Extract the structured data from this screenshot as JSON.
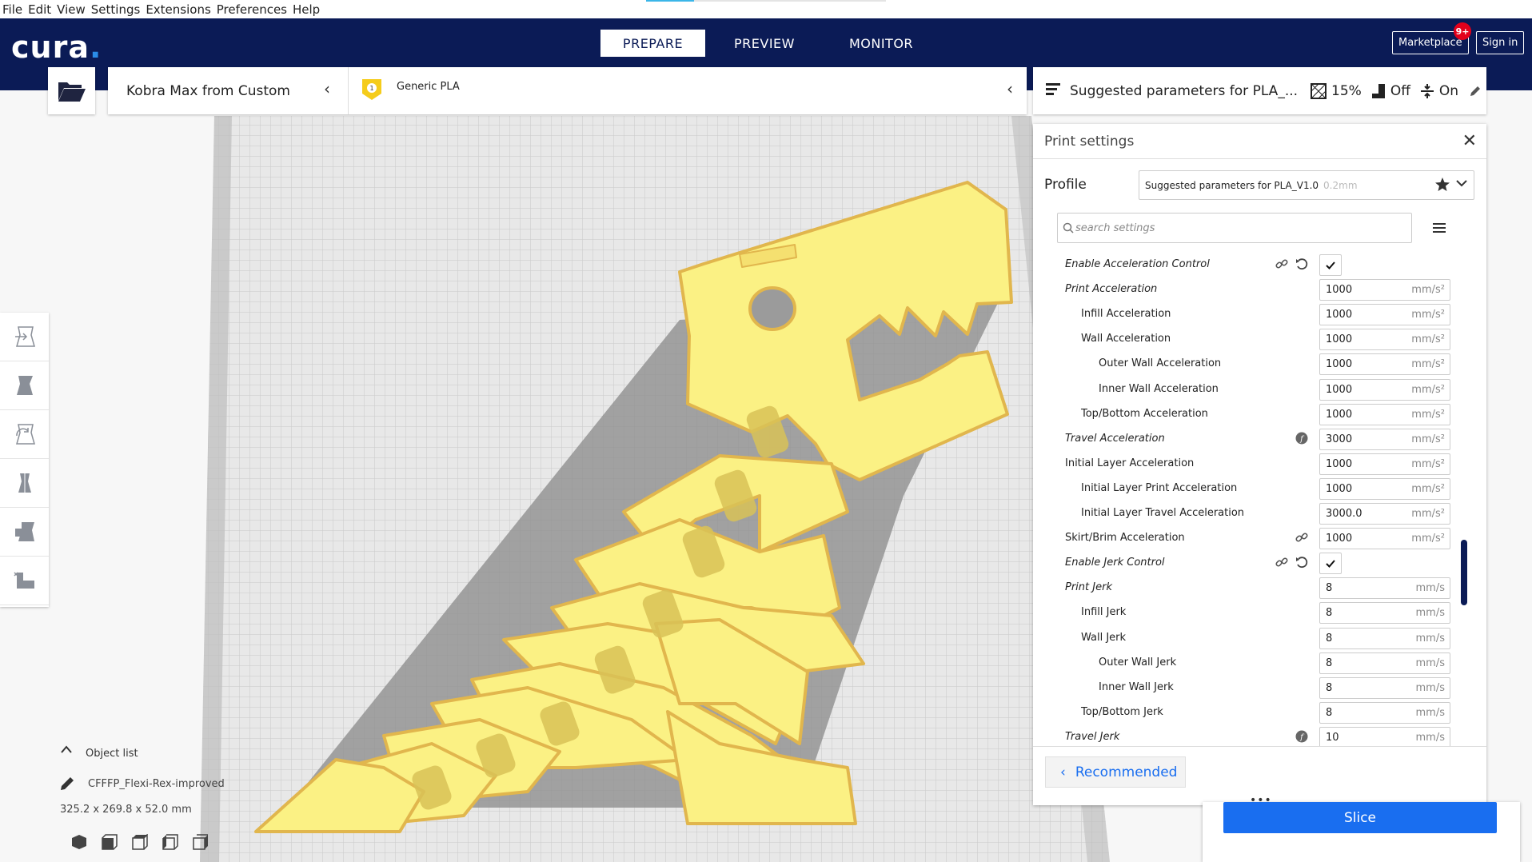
{
  "menu": [
    "File",
    "Edit",
    "View",
    "Settings",
    "Extensions",
    "Preferences",
    "Help"
  ],
  "brand": {
    "logo": "cura",
    "navy": "#0b1b56",
    "accent": "#196ef0"
  },
  "stages": [
    {
      "label": "PREPARE",
      "active": true
    },
    {
      "label": "PREVIEW",
      "active": false
    },
    {
      "label": "MONITOR",
      "active": false
    }
  ],
  "header_buttons": {
    "marketplace": "Marketplace",
    "marketplace_badge": "9+",
    "sign_in": "Sign in"
  },
  "printer": {
    "name": "Kobra Max from Custom"
  },
  "material": {
    "extruder_number": "1",
    "name": "Generic PLA",
    "color": "#f5cc1b"
  },
  "profile_bar": {
    "name": "Suggested parameters for PLA_...",
    "infill": "15%",
    "support": "Off",
    "adhesion": "On"
  },
  "print_settings": {
    "title": "Print settings",
    "profile_label": "Profile",
    "profile_value": "Suggested parameters for PLA_V1.0",
    "profile_sub": "0.2mm",
    "search_placeholder": "search settings",
    "rows": [
      {
        "label": "Enable Acceleration Control",
        "italic": true,
        "indent": 0,
        "type": "check",
        "link": true,
        "reset": true
      },
      {
        "label": "Print Acceleration",
        "italic": true,
        "indent": 0,
        "value": "1000",
        "unit": "mm/s²"
      },
      {
        "label": "Infill Acceleration",
        "italic": false,
        "indent": 1,
        "value": "1000",
        "unit": "mm/s²"
      },
      {
        "label": "Wall Acceleration",
        "italic": false,
        "indent": 1,
        "value": "1000",
        "unit": "mm/s²"
      },
      {
        "label": "Outer Wall Acceleration",
        "italic": false,
        "indent": 2,
        "value": "1000",
        "unit": "mm/s²"
      },
      {
        "label": "Inner Wall Acceleration",
        "italic": false,
        "indent": 2,
        "value": "1000",
        "unit": "mm/s²"
      },
      {
        "label": "Top/Bottom Acceleration",
        "italic": false,
        "indent": 1,
        "value": "1000",
        "unit": "mm/s²"
      },
      {
        "label": "Travel Acceleration",
        "italic": true,
        "indent": 0,
        "value": "3000",
        "unit": "mm/s²",
        "info": true
      },
      {
        "label": "Initial Layer Acceleration",
        "italic": false,
        "indent": 0,
        "value": "1000",
        "unit": "mm/s²"
      },
      {
        "label": "Initial Layer Print Acceleration",
        "italic": false,
        "indent": 1,
        "value": "1000",
        "unit": "mm/s²"
      },
      {
        "label": "Initial Layer Travel Acceleration",
        "italic": false,
        "indent": 1,
        "value": "3000.0",
        "unit": "mm/s²"
      },
      {
        "label": "Skirt/Brim Acceleration",
        "italic": false,
        "indent": 0,
        "value": "1000",
        "unit": "mm/s²",
        "link": true
      },
      {
        "label": "Enable Jerk Control",
        "italic": true,
        "indent": 0,
        "type": "check",
        "link": true,
        "reset": true
      },
      {
        "label": "Print Jerk",
        "italic": true,
        "indent": 0,
        "value": "8",
        "unit": "mm/s"
      },
      {
        "label": "Infill Jerk",
        "italic": false,
        "indent": 1,
        "value": "8",
        "unit": "mm/s"
      },
      {
        "label": "Wall Jerk",
        "italic": false,
        "indent": 1,
        "value": "8",
        "unit": "mm/s"
      },
      {
        "label": "Outer Wall Jerk",
        "italic": false,
        "indent": 2,
        "value": "8",
        "unit": "mm/s"
      },
      {
        "label": "Inner Wall Jerk",
        "italic": false,
        "indent": 2,
        "value": "8",
        "unit": "mm/s"
      },
      {
        "label": "Top/Bottom Jerk",
        "italic": false,
        "indent": 1,
        "value": "8",
        "unit": "mm/s"
      },
      {
        "label": "Travel Jerk",
        "italic": true,
        "indent": 0,
        "value": "10",
        "unit": "mm/s",
        "info": true
      }
    ],
    "recommended_button": "Recommended"
  },
  "slice_button": "Slice",
  "object_list": {
    "title": "Object list",
    "object_name": "CFFFP_Flexi-Rex-improved",
    "dimensions": "325.2 x 269.8 x 52.0 mm"
  }
}
